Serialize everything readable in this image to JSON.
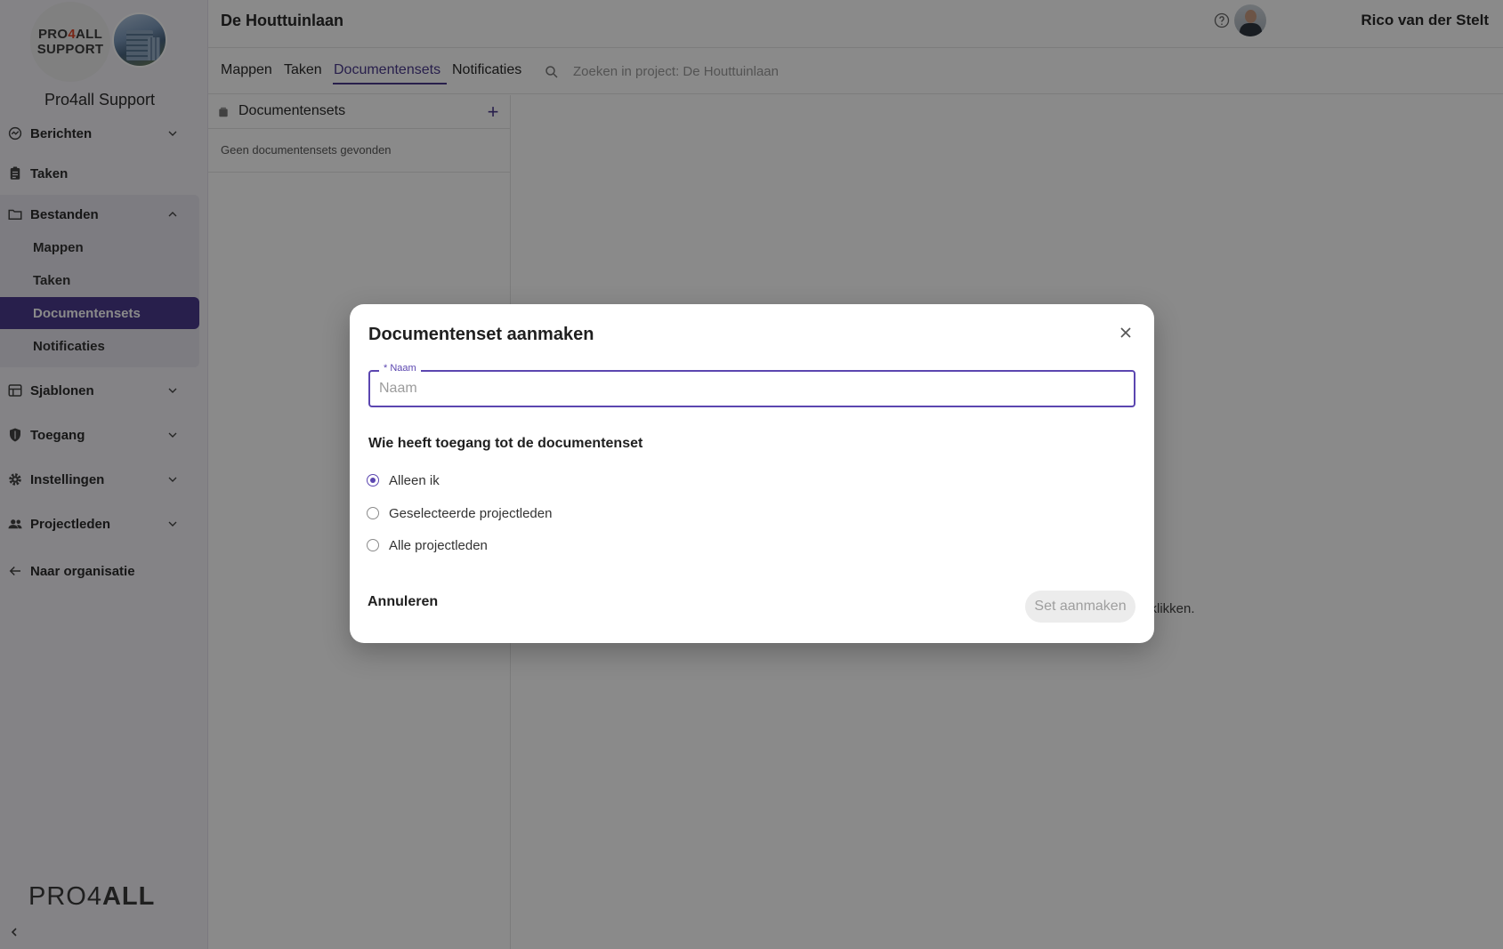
{
  "sidebar": {
    "org_logo_line1_pre": "PRO",
    "org_logo_line1_four": "4",
    "org_logo_line1_post": "ALL",
    "org_logo_line2": "SUPPORT",
    "org_name": "Pro4all Support",
    "nav": {
      "berichten": "Berichten",
      "taken": "Taken",
      "bestanden": "Bestanden",
      "sjablonen": "Sjablonen",
      "toegang": "Toegang",
      "instellingen": "Instellingen",
      "projectleden": "Projectleden",
      "naar_organisatie": "Naar organisatie"
    },
    "bestanden_sub": {
      "mappen": "Mappen",
      "taken": "Taken",
      "documentensets": "Documentensets",
      "notificaties": "Notificaties"
    },
    "brand_light": "PRO4",
    "brand_bold": "ALL"
  },
  "header": {
    "project_title": "De Houttuinlaan",
    "user_name": "Rico van der Stelt"
  },
  "tabs": {
    "mappen": "Mappen",
    "taken": "Taken",
    "documentensets": "Documentensets",
    "notificaties": "Notificaties",
    "active": "Documentensets",
    "search_placeholder": "Zoeken in project: De Houttuinlaan"
  },
  "panel": {
    "title": "Documentensets",
    "empty_text": "Geen documentensets gevonden",
    "background_hint_fragment": "e klikken."
  },
  "modal": {
    "title": "Documentenset aanmaken",
    "name_label": "* Naam",
    "name_placeholder": "Naam",
    "name_value": "",
    "access_title": "Wie heeft toegang tot de documentenset",
    "options": [
      "Alleen ik",
      "Geselecteerde projectleden",
      "Alle projectleden"
    ],
    "selected_option": "Alleen ik",
    "cancel_label": "Annuleren",
    "create_label": "Set aanmaken"
  },
  "colors": {
    "accent": "#4a3a8c",
    "focus": "#5b46b0",
    "logo_four": "#e0472a"
  }
}
